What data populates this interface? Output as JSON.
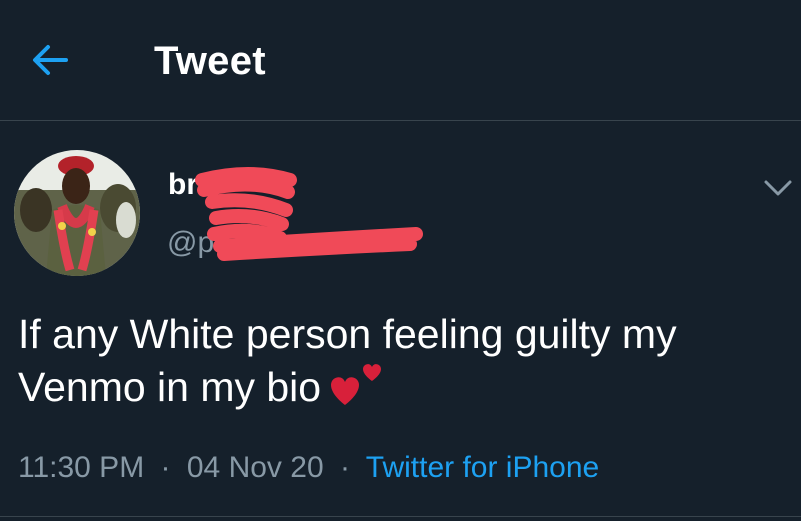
{
  "header": {
    "title": "Tweet",
    "back_icon": "arrow-left-icon"
  },
  "tweet": {
    "author": {
      "display_name": "bra",
      "handle": "@p"
    },
    "text": "If any White person feeling guilty my Venmo in my bio",
    "emoji": "two-hearts-icon",
    "time": "11:30 PM",
    "date": "04 Nov 20",
    "separator": "·",
    "source": "Twitter for iPhone"
  },
  "colors": {
    "background": "#15202b",
    "accent": "#1da1f2",
    "secondary_text": "#8899a6",
    "divider": "#38444d",
    "redaction": "#f04a58"
  }
}
